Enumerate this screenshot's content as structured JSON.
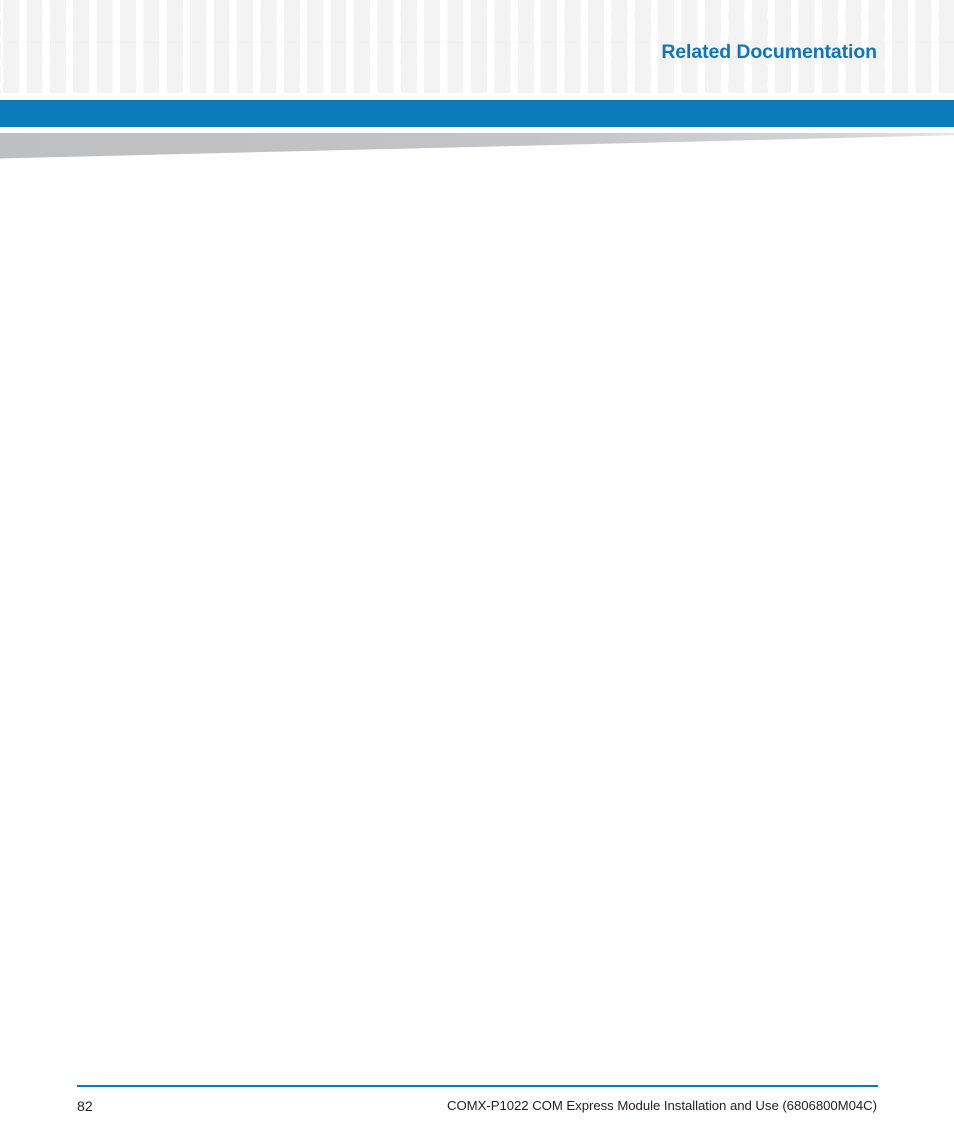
{
  "document": {
    "header": {
      "chapter_title": "Related Documentation",
      "accent_color": "#1175b8",
      "bar_color": "#0a7ab8",
      "wedge_color": "#bdbfc1",
      "pattern_square_color": "#f3f3f3"
    },
    "body": {
      "content": ""
    },
    "footer": {
      "page_number": "82",
      "doc_title": "COMX-P1022 COM Express Module Installation and Use (6806800M04C)",
      "rule_color": "#0a7ab8"
    }
  }
}
